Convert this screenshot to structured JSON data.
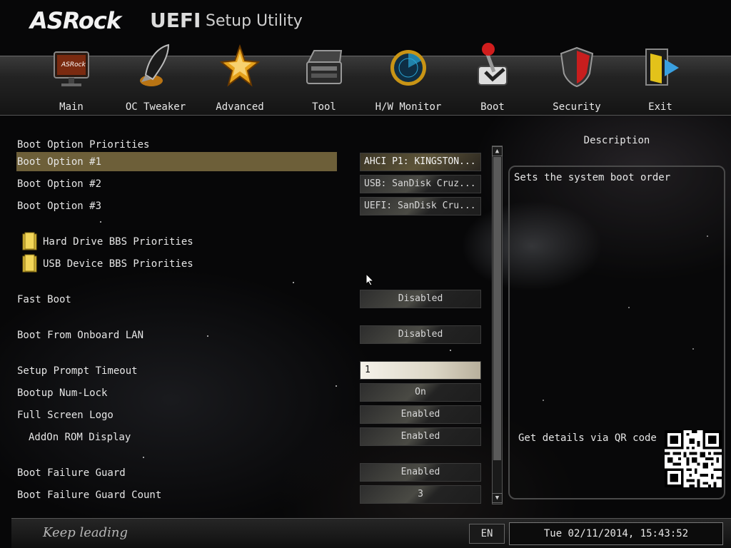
{
  "header": {
    "brand": "ASRock",
    "product": "UEFI",
    "subtitle": "Setup Utility"
  },
  "tabs": [
    {
      "label": "Main",
      "icon": "monitor-icon"
    },
    {
      "label": "OC Tweaker",
      "icon": "rocket-icon"
    },
    {
      "label": "Advanced",
      "icon": "star-icon"
    },
    {
      "label": "Tool",
      "icon": "toolbox-icon"
    },
    {
      "label": "H/W Monitor",
      "icon": "radar-icon"
    },
    {
      "label": "Boot",
      "icon": "joystick-icon"
    },
    {
      "label": "Security",
      "icon": "shield-icon"
    },
    {
      "label": "Exit",
      "icon": "exit-door-icon"
    }
  ],
  "active_tab": "Boot",
  "section_title": "Boot Option Priorities",
  "boot_options": [
    {
      "label": "Boot Option #1",
      "value": "AHCI P1: KINGSTON..."
    },
    {
      "label": "Boot Option #2",
      "value": "USB: SanDisk Cruz..."
    },
    {
      "label": "Boot Option #3",
      "value": "UEFI: SanDisk Cru..."
    }
  ],
  "submenus": [
    {
      "label": "Hard Drive BBS Priorities"
    },
    {
      "label": "USB Device BBS Priorities"
    }
  ],
  "settings": {
    "fast_boot": {
      "label": "Fast Boot",
      "value": "Disabled"
    },
    "onboard_lan": {
      "label": "Boot From Onboard LAN",
      "value": "Disabled"
    },
    "prompt_timeout": {
      "label": "Setup Prompt Timeout",
      "value": "1"
    },
    "numlock": {
      "label": "Bootup Num-Lock",
      "value": "On"
    },
    "full_logo": {
      "label": "Full Screen Logo",
      "value": "Enabled"
    },
    "addon_rom": {
      "label": "AddOn ROM Display",
      "value": "Enabled"
    },
    "failure_guard": {
      "label": "Boot Failure Guard",
      "value": "Enabled"
    },
    "failure_count": {
      "label": "Boot Failure Guard Count",
      "value": "3"
    }
  },
  "description": {
    "title": "Description",
    "text": "Sets the system boot order",
    "qr_label": "Get details via QR code"
  },
  "footer": {
    "slogan": "Keep leading",
    "language": "EN",
    "datetime": "Tue 02/11/2014, 15:43:52"
  },
  "colors": {
    "highlight": "#6d5f39",
    "panel_border": "#4a4a4a"
  }
}
